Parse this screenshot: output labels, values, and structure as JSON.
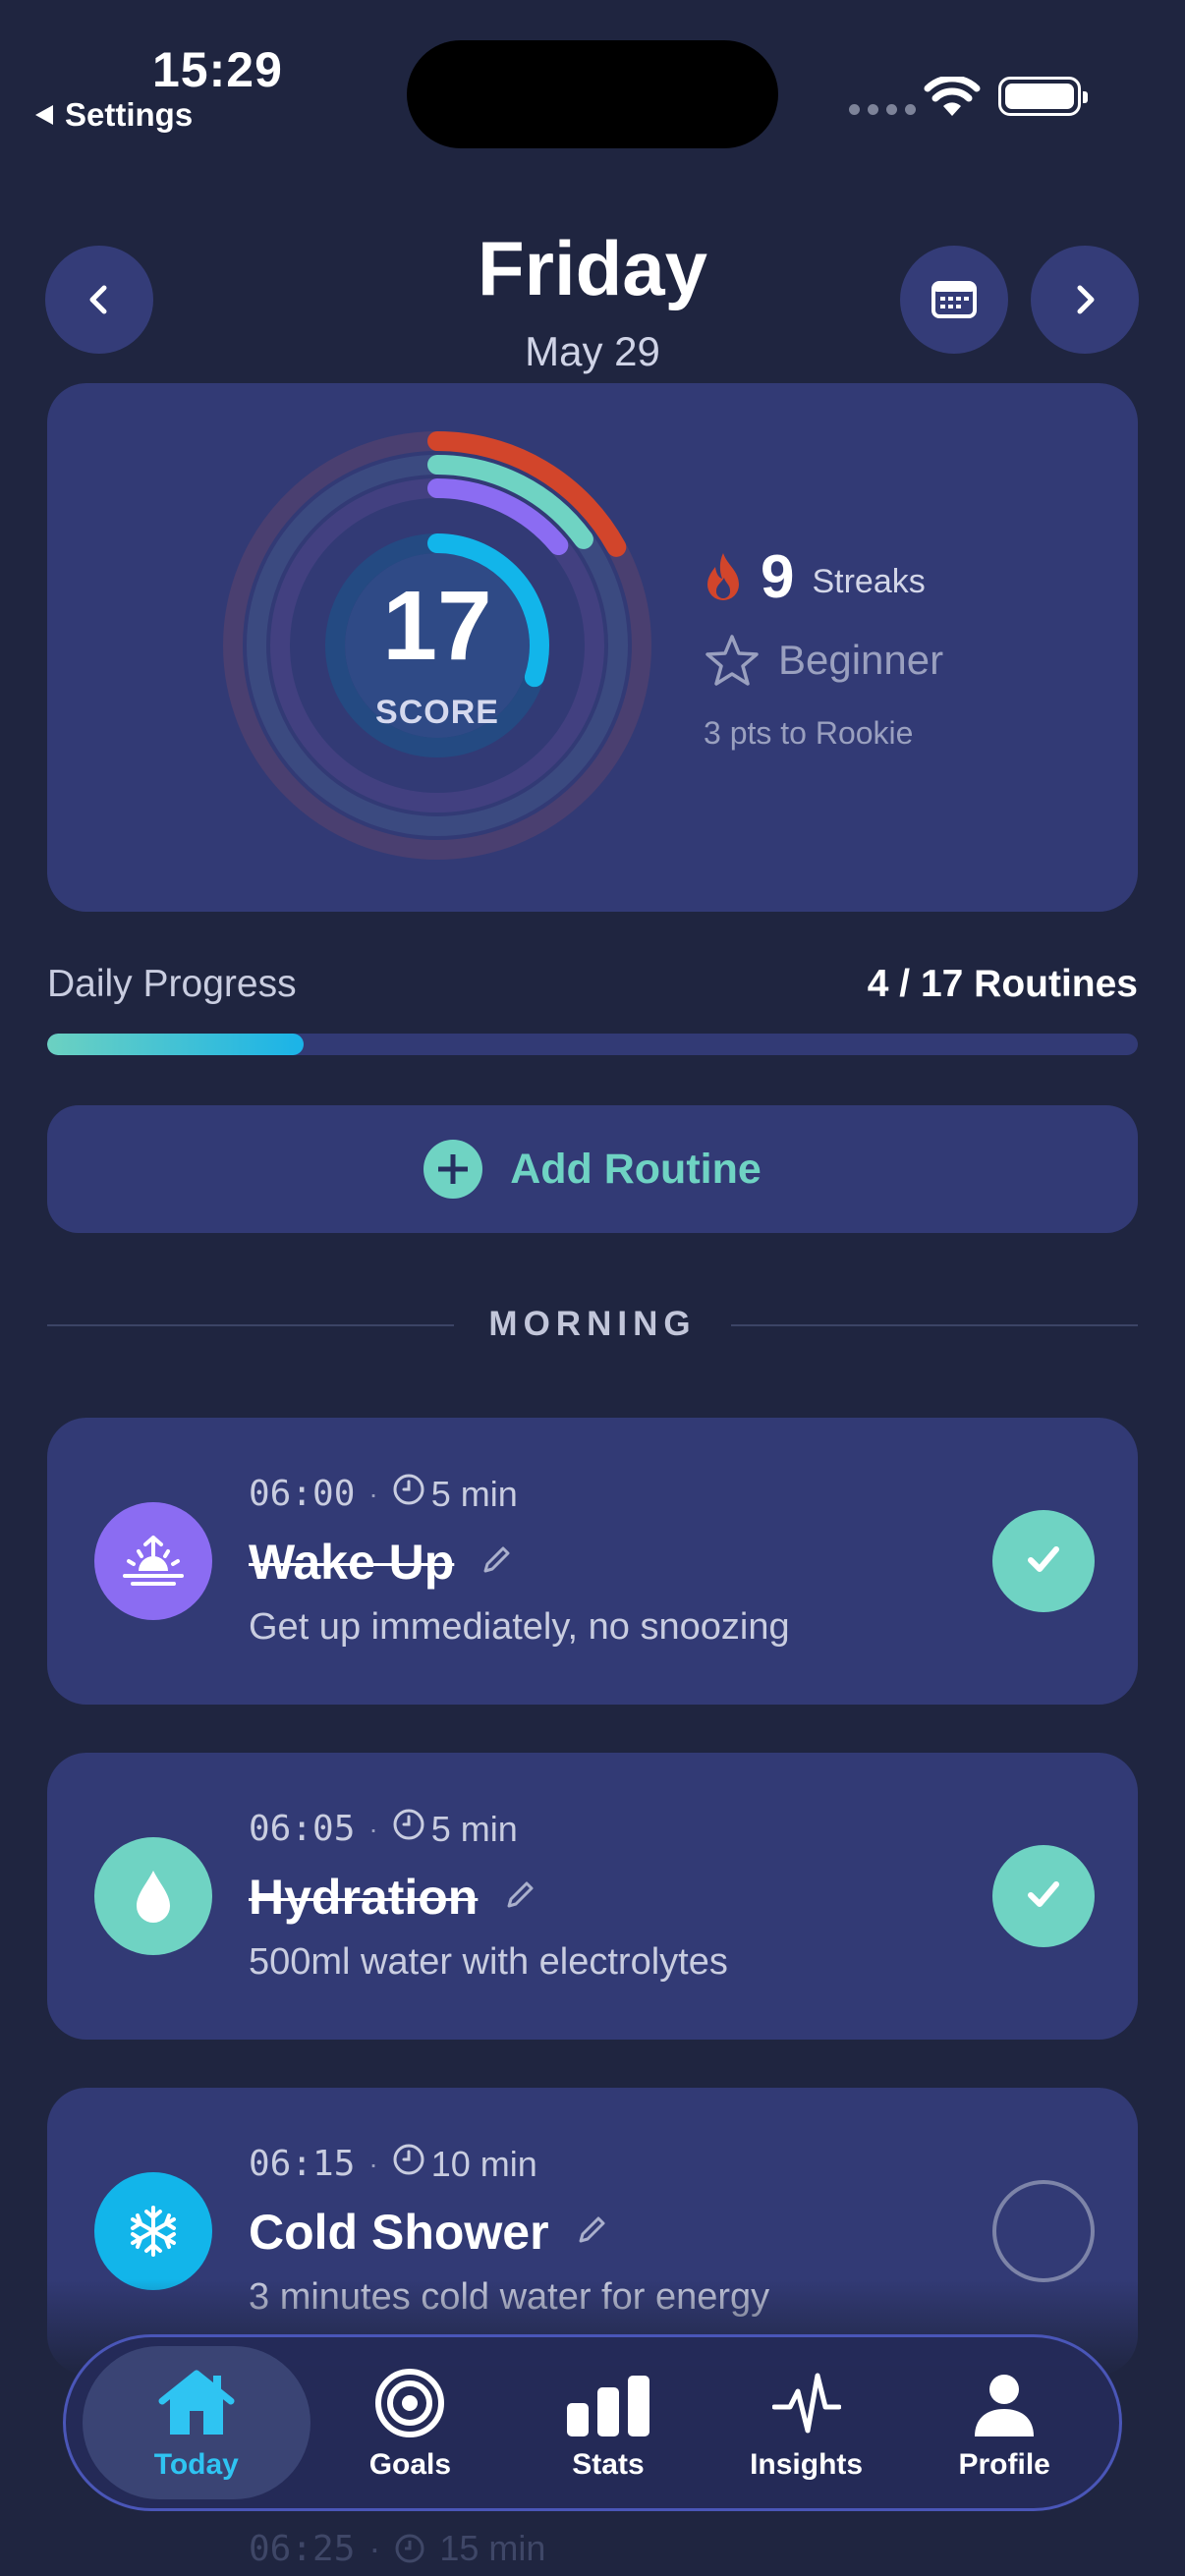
{
  "status_bar": {
    "time": "15:29",
    "back_label": "Settings"
  },
  "header": {
    "day": "Friday",
    "date": "May 29"
  },
  "score": {
    "value": "17",
    "label": "SCORE",
    "streak_count": "9",
    "streak_label": "Streaks",
    "level": "Beginner",
    "next_level": "3 pts to Rookie",
    "rings": [
      {
        "color": "#d2452b",
        "fraction": 0.17
      },
      {
        "color": "#6fd3c3",
        "fraction": 0.15
      },
      {
        "color": "#8b6cf2",
        "fraction": 0.14
      },
      {
        "color": "#12b5ea",
        "fraction": 0.3
      }
    ]
  },
  "progress": {
    "label": "Daily Progress",
    "count": "4 / 17 Routines",
    "fraction": 0.235
  },
  "add_routine": {
    "label": "Add Routine"
  },
  "section": {
    "title": "MORNING"
  },
  "routines": [
    {
      "time": "06:00",
      "duration": "5 min",
      "title": "Wake Up",
      "desc": "Get up immediately, no snoozing",
      "icon": "sunrise-icon",
      "color": "#8b6cf2",
      "done": true
    },
    {
      "time": "06:05",
      "duration": "5 min",
      "title": "Hydration",
      "desc": "500ml water with electrolytes",
      "icon": "water-drop-icon",
      "color": "#6fd3c3",
      "done": true
    },
    {
      "time": "06:15",
      "duration": "10 min",
      "title": "Cold Shower",
      "desc": "3 minutes cold water for energy",
      "icon": "snowflake-icon",
      "color": "#12b5ea",
      "done": false
    }
  ],
  "ghost_routine": {
    "time": "06:25",
    "duration": "15 min"
  },
  "tabs": [
    {
      "label": "Today",
      "icon": "home-icon",
      "active": true
    },
    {
      "label": "Goals",
      "icon": "target-icon",
      "active": false
    },
    {
      "label": "Stats",
      "icon": "bar-chart-icon",
      "active": false
    },
    {
      "label": "Insights",
      "icon": "pulse-icon",
      "active": false
    },
    {
      "label": "Profile",
      "icon": "person-icon",
      "active": false
    }
  ]
}
